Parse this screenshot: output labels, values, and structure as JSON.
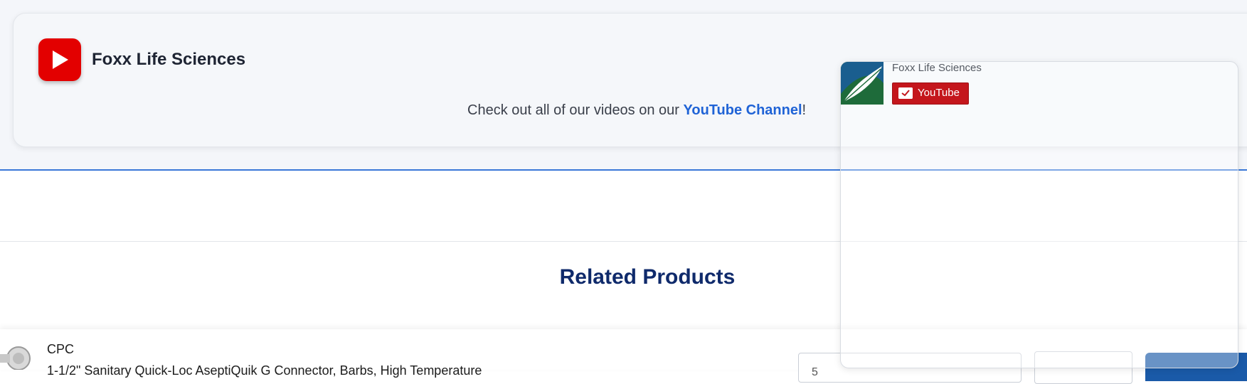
{
  "card": {
    "title": "Foxx Life Sciences",
    "text_prefix": "Check out all of our videos on our ",
    "link_text": "YouTube Channel",
    "text_suffix": "!"
  },
  "related": {
    "title": "Related Products"
  },
  "product": {
    "brand": "CPC",
    "name": "1-1/2\" Sanitary Quick-Loc AseptiQuik G Connector, Barbs, High Temperature",
    "quantity_placeholder": "5"
  },
  "widget": {
    "channel_name": "Foxx Life Sciences",
    "subscribe_label": "YouTube"
  },
  "colors": {
    "accent": "#1f63d6",
    "youtube_red": "#e30000",
    "heading": "#0f2a6b",
    "subscribe": "#c4161c"
  }
}
